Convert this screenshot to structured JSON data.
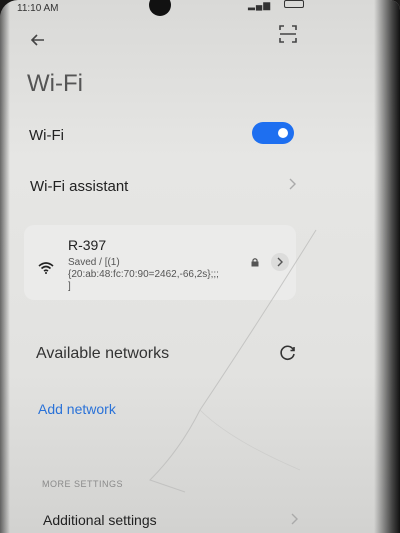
{
  "status_bar": {
    "time": "11:10 AM"
  },
  "header": {
    "title": "Wi-Fi"
  },
  "wifi_toggle": {
    "label": "Wi-Fi",
    "state": "on",
    "accent": "#1e6ff0"
  },
  "wifi_assistant": {
    "label": "Wi-Fi assistant"
  },
  "saved_network": {
    "name": "R-397",
    "detail_line1": "Saved / [(1)",
    "detail_line2": "{20:ab:48:fc:70:90=2462,-66,2s};;;",
    "detail_line3": "]"
  },
  "available": {
    "label": "Available networks"
  },
  "add_network": {
    "label": "Add network"
  },
  "more_settings": {
    "header": "MORE SETTINGS"
  },
  "additional_settings": {
    "label": "Additional settings"
  },
  "icons": [
    "back-arrow-icon",
    "scan-icon",
    "wifi-signal-icon",
    "lock-icon",
    "chevron-right-icon",
    "refresh-icon"
  ]
}
